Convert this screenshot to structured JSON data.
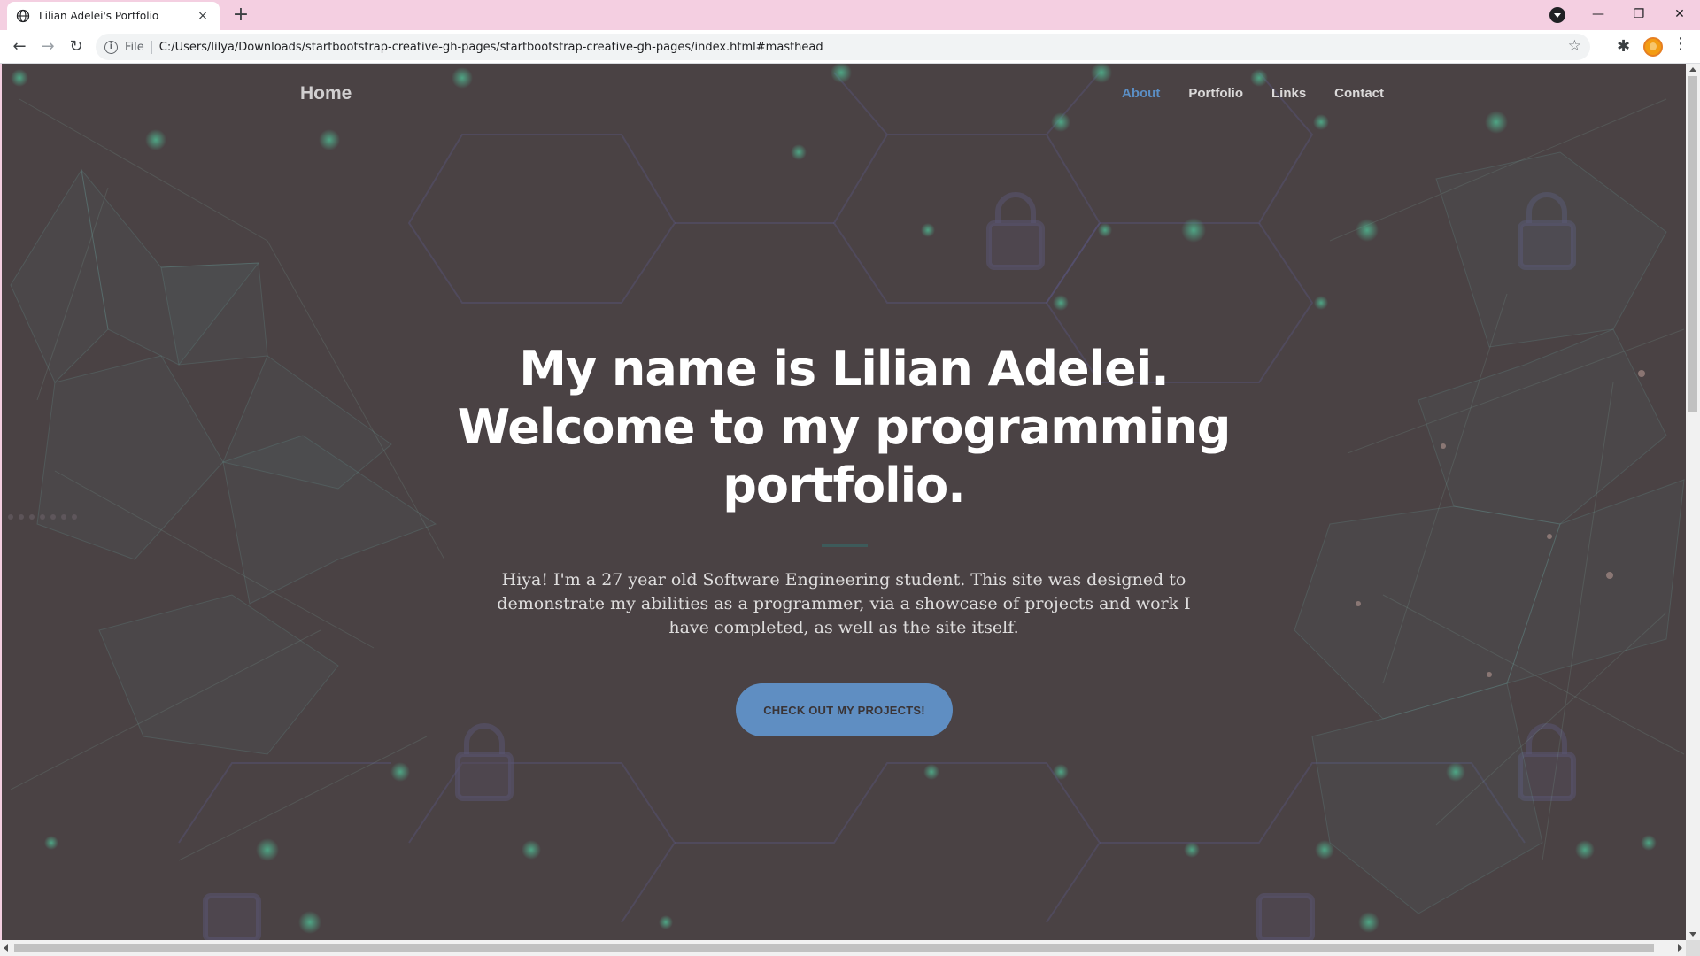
{
  "browser": {
    "tab_title": "Lilian Adelei's Portfolio",
    "tab_close": "×",
    "new_tab": "+",
    "url_scheme": "File",
    "url": "C:/Users/lilya/Downloads/startbootstrap-creative-gh-pages/startbootstrap-creative-gh-pages/index.html#masthead",
    "nav_back": "←",
    "nav_forward": "→",
    "nav_reload": "↻",
    "star": "☆",
    "extensions": "✱",
    "menu": "⋮",
    "minimize": "—",
    "restore": "❐",
    "close": "✕"
  },
  "site": {
    "brand": "Home",
    "nav": [
      {
        "label": "About",
        "active": true
      },
      {
        "label": "Portfolio"
      },
      {
        "label": "Links"
      },
      {
        "label": "Contact"
      }
    ],
    "hero": {
      "title_line1": "My name is Lilian Adelei.",
      "title_line2": "Welcome to my programming",
      "title_line3": "portfolio.",
      "text": "Hiya! I'm a 27 year old Software Engineering student. This site was designed to demonstrate my abilities as a programmer, via a showcase of projects and work I have completed, as well as the site itself.",
      "cta": "CHECK OUT MY PROJECTS!"
    }
  },
  "colors": {
    "overlay": "#4a4244",
    "accent": "#5f8ec2",
    "active_link": "#5b8ec4"
  }
}
